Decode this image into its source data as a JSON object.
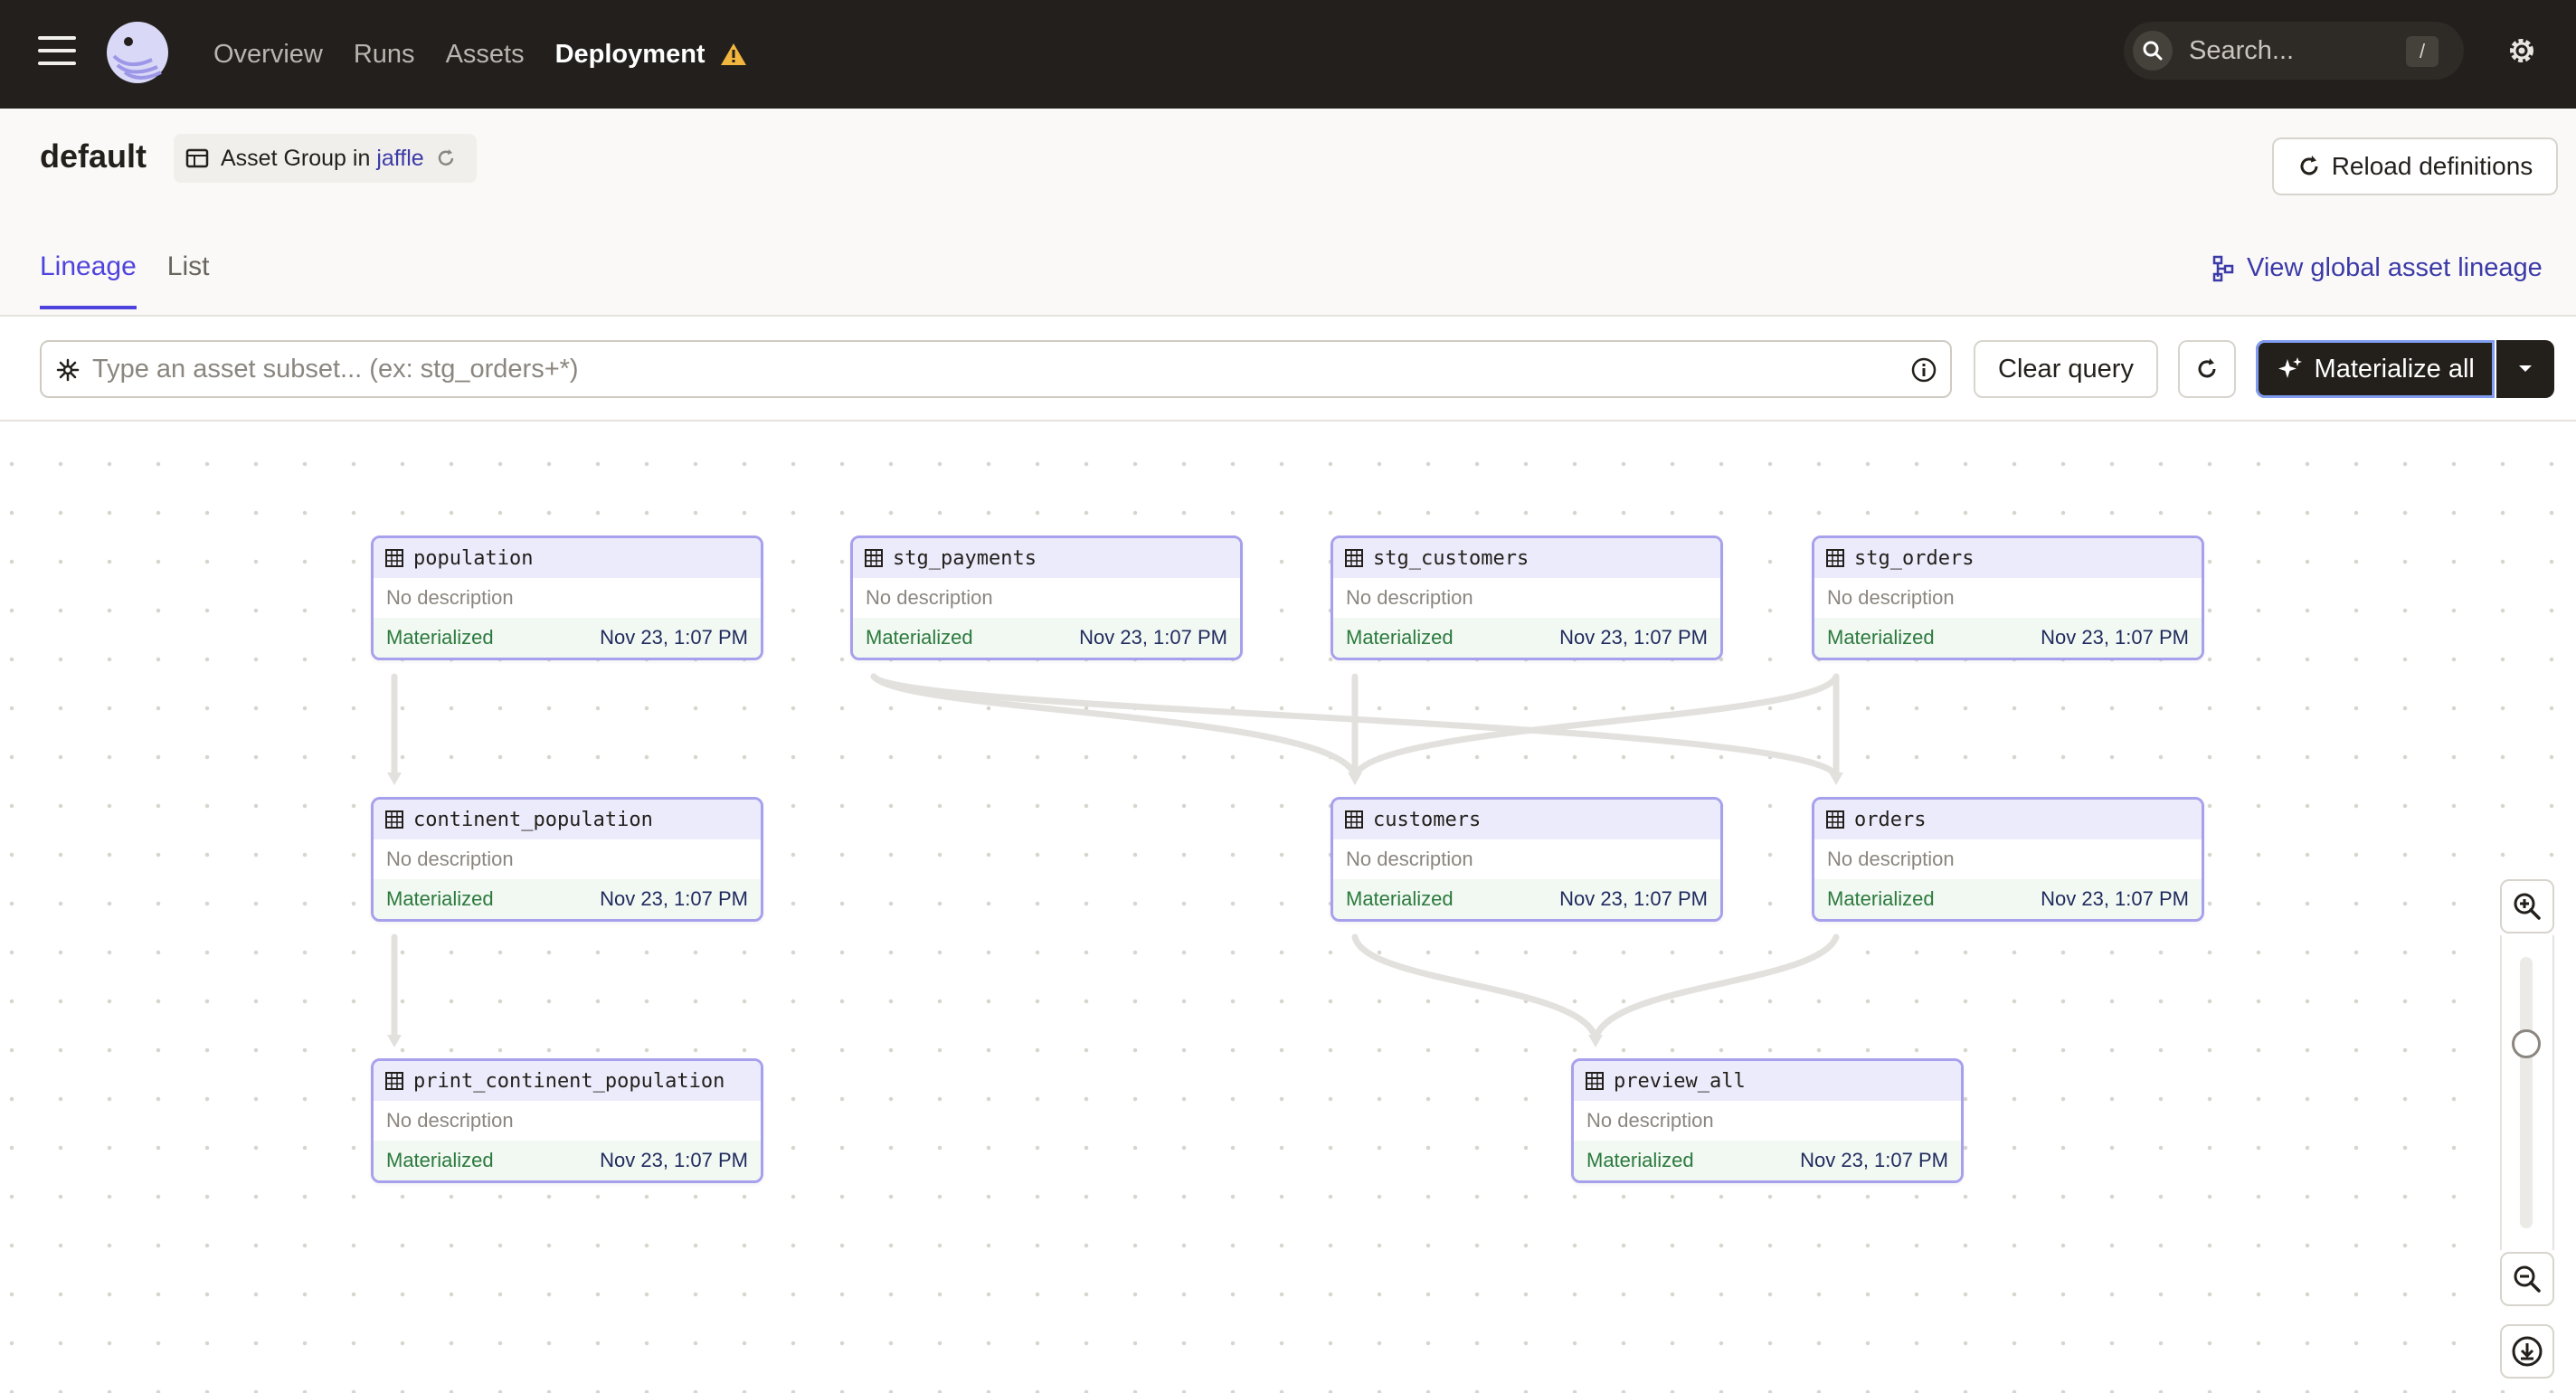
{
  "nav": {
    "links": [
      "Overview",
      "Runs",
      "Assets"
    ],
    "active_link": "Deployment",
    "search_placeholder": "Search...",
    "search_shortcut": "/"
  },
  "header": {
    "title": "default",
    "group_prefix": "Asset Group in",
    "group_location": "jaffle",
    "reload_label": "Reload definitions"
  },
  "tabs": [
    "Lineage",
    "List"
  ],
  "active_tab": "Lineage",
  "global_lineage_label": "View global asset lineage",
  "query": {
    "placeholder": "Type an asset subset... (ex: stg_orders+*)",
    "value": "",
    "clear_label": "Clear query",
    "materialize_label": "Materialize all"
  },
  "assets": [
    {
      "name": "population",
      "description": "No description",
      "status": "Materialized",
      "time": "Nov 23, 1:07 PM"
    },
    {
      "name": "stg_payments",
      "description": "No description",
      "status": "Materialized",
      "time": "Nov 23, 1:07 PM"
    },
    {
      "name": "stg_customers",
      "description": "No description",
      "status": "Materialized",
      "time": "Nov 23, 1:07 PM"
    },
    {
      "name": "stg_orders",
      "description": "No description",
      "status": "Materialized",
      "time": "Nov 23, 1:07 PM"
    },
    {
      "name": "continent_population",
      "description": "No description",
      "status": "Materialized",
      "time": "Nov 23, 1:07 PM"
    },
    {
      "name": "customers",
      "description": "No description",
      "status": "Materialized",
      "time": "Nov 23, 1:07 PM"
    },
    {
      "name": "orders",
      "description": "No description",
      "status": "Materialized",
      "time": "Nov 23, 1:07 PM"
    },
    {
      "name": "print_continent_population",
      "description": "No description",
      "status": "Materialized",
      "time": "Nov 23, 1:07 PM"
    },
    {
      "name": "preview_all",
      "description": "No description",
      "status": "Materialized",
      "time": "Nov 23, 1:07 PM"
    }
  ],
  "edges": [
    [
      "population",
      "continent_population"
    ],
    [
      "continent_population",
      "print_continent_population"
    ],
    [
      "stg_payments",
      "customers"
    ],
    [
      "stg_payments",
      "orders"
    ],
    [
      "stg_customers",
      "customers"
    ],
    [
      "stg_orders",
      "customers"
    ],
    [
      "stg_orders",
      "orders"
    ],
    [
      "customers",
      "preview_all"
    ],
    [
      "orders",
      "preview_all"
    ]
  ],
  "colors": {
    "topbar": "#221f1c",
    "accent": "#4f43dd",
    "node_border": "#a7a0ec",
    "materialized": "#2b7a3d"
  },
  "icons": {
    "menu": "hamburger-icon",
    "logo": "dagster-logo",
    "warning": "warning-icon",
    "search": "search-icon",
    "settings": "gear-icon",
    "asset": "table-icon"
  }
}
